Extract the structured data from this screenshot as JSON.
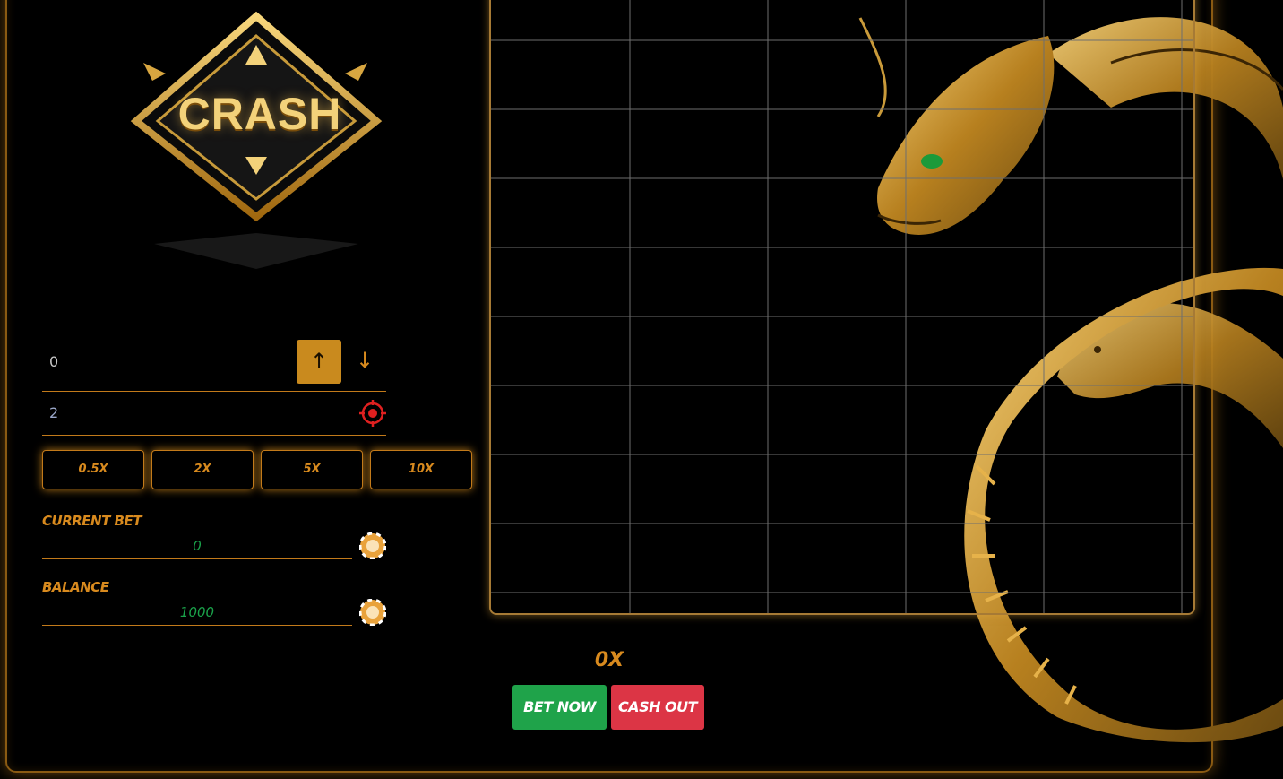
{
  "logo": {
    "text": "CRASH"
  },
  "bet_controls": {
    "amount_value": "0",
    "up_label": "↑",
    "down_label": "↓",
    "target_value": "2",
    "multipliers": [
      "0.5X",
      "2X",
      "5X",
      "10X"
    ]
  },
  "stats": {
    "current_bet_label": "CURRENT BET",
    "current_bet_value": "0",
    "balance_label": "BALANCE",
    "balance_value": "1000"
  },
  "game": {
    "multiplier": "0X",
    "bet_button": "BET NOW",
    "cashout_button": "CASH OUT"
  },
  "colors": {
    "accent": "#d88a1e",
    "bet": "#1fa34a",
    "cashout": "#dc3545",
    "value_green": "#1aa24a"
  }
}
